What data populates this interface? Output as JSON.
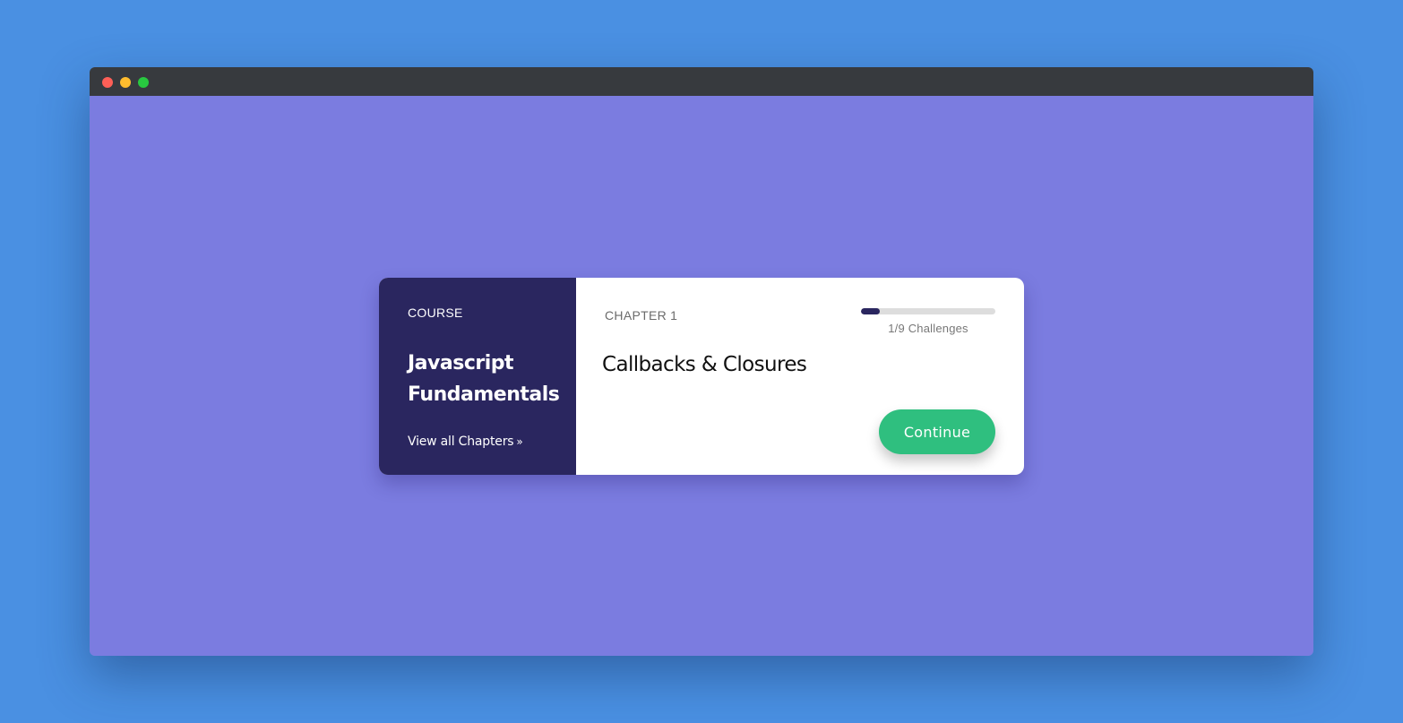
{
  "window": {
    "controls": [
      "close",
      "minimize",
      "maximize"
    ],
    "colors": {
      "page_background": "#4a90e2",
      "titlebar": "#373a3e",
      "content_background": "#7b7ce0"
    }
  },
  "card": {
    "preview": {
      "label": "COURSE",
      "title": "Javascript Fundamentals",
      "link_label": "View all Chapters",
      "link_icon": "double-chevron-right-icon",
      "link_icon_glyph": "»",
      "background_color": "#2a265f"
    },
    "info": {
      "chapter_label": "CHAPTER 1",
      "chapter_title": "Callbacks & Closures",
      "progress": {
        "completed": 1,
        "total": 9,
        "fraction": 0.111,
        "text": "1/9 Challenges",
        "fill_color": "#2a265f",
        "track_color": "#dddddd"
      },
      "button_label": "Continue",
      "button_color": "#2fbf7f"
    }
  }
}
